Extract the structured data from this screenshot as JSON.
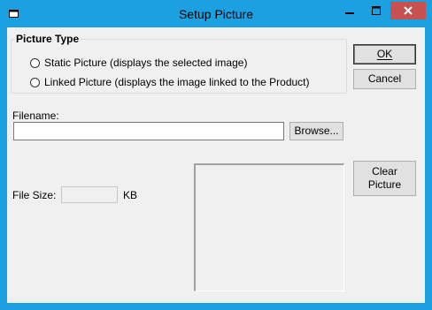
{
  "window": {
    "title": "Setup Picture",
    "minimize_glyph": "—",
    "maximize_glyph": "☐",
    "close_glyph": "✕"
  },
  "picture_type": {
    "legend": "Picture Type",
    "options": [
      {
        "label": "Static Picture (displays the selected image)",
        "selected": false
      },
      {
        "label": "Linked Picture (displays the image linked to the Product)",
        "selected": false
      }
    ]
  },
  "buttons": {
    "ok": "OK",
    "cancel": "Cancel",
    "browse": "Browse...",
    "clear_picture_line1": "Clear",
    "clear_picture_line2": "Picture"
  },
  "filename": {
    "label": "Filename:",
    "value": ""
  },
  "file_size": {
    "label": "File Size:",
    "value": "",
    "unit": "KB"
  },
  "icons": {
    "app": "window-icon",
    "minimize": "minimize-icon",
    "maximize": "maximize-icon",
    "close": "close-icon"
  },
  "colors": {
    "titlebar": "#1ba1e2",
    "close_button": "#c75050",
    "client_bg": "#f0f0f0"
  }
}
